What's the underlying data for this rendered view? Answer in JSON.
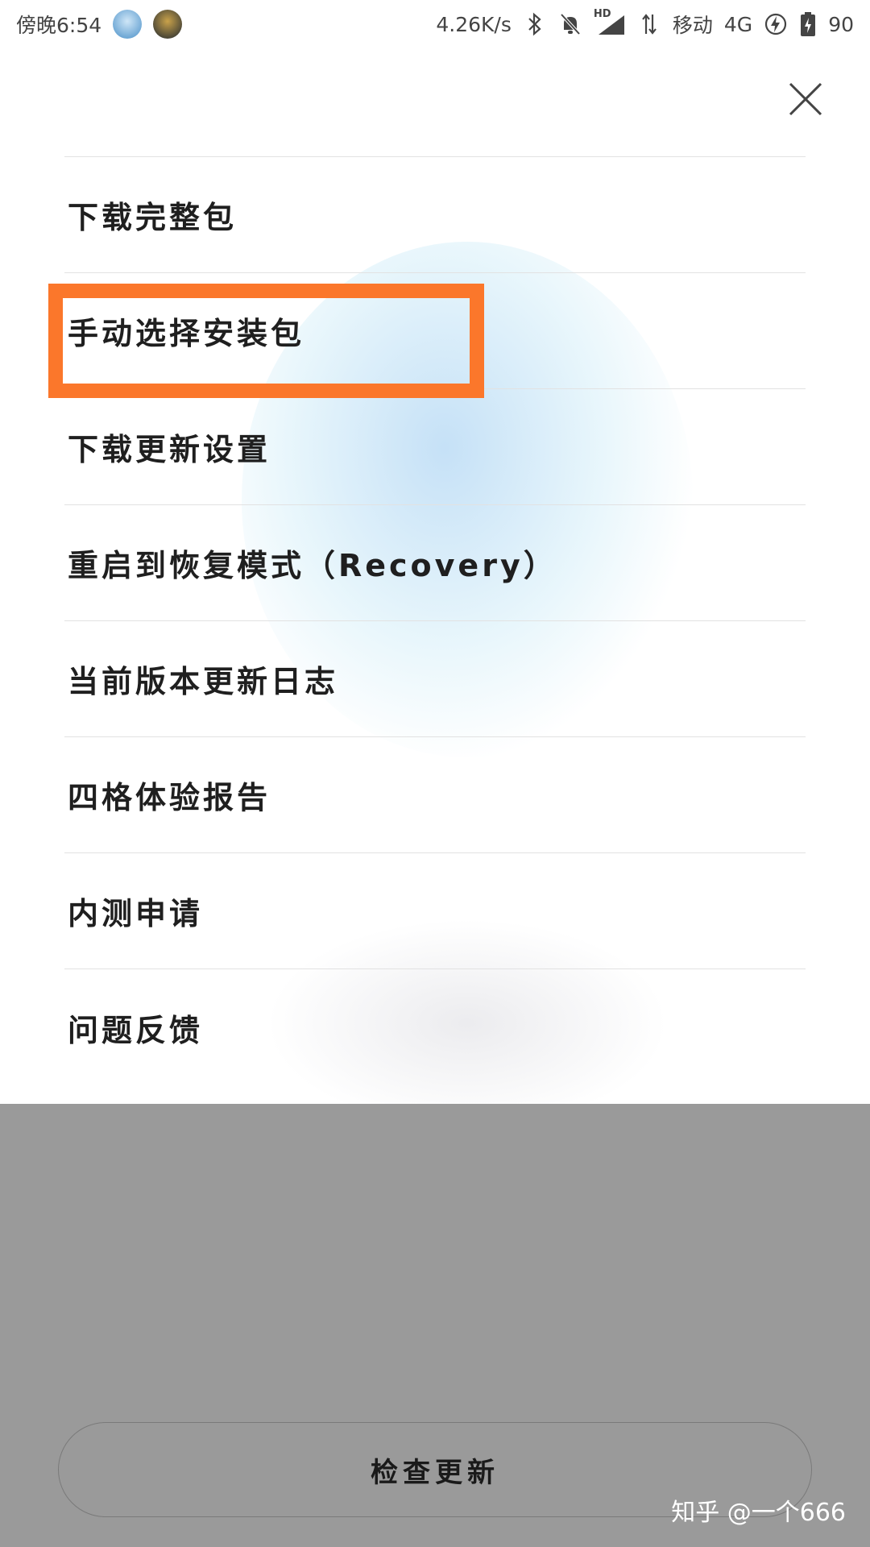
{
  "status_bar": {
    "time": "傍晚6:54",
    "net_speed": "4.26K/s",
    "hd": "HD",
    "carrier": "移动",
    "network": "4G",
    "battery": "90",
    "icons": [
      "bluetooth-icon",
      "mute-bell-icon",
      "signal-icon",
      "data-arrows-icon",
      "charging-icon",
      "battery-icon"
    ]
  },
  "menu": {
    "items": [
      {
        "label": "下载完整包"
      },
      {
        "label": "手动选择安装包"
      },
      {
        "label": "下载更新设置"
      },
      {
        "label": "重启到恢复模式（Recovery）"
      },
      {
        "label": "当前版本更新日志"
      },
      {
        "label": "四格体验报告"
      },
      {
        "label": "内测申请"
      },
      {
        "label": "问题反馈"
      }
    ]
  },
  "check_update": {
    "label": "检查更新"
  },
  "watermark": "知乎 @一个666",
  "colors": {
    "highlight": "#fb772b",
    "dim_overlay": "#9a9a9a"
  }
}
